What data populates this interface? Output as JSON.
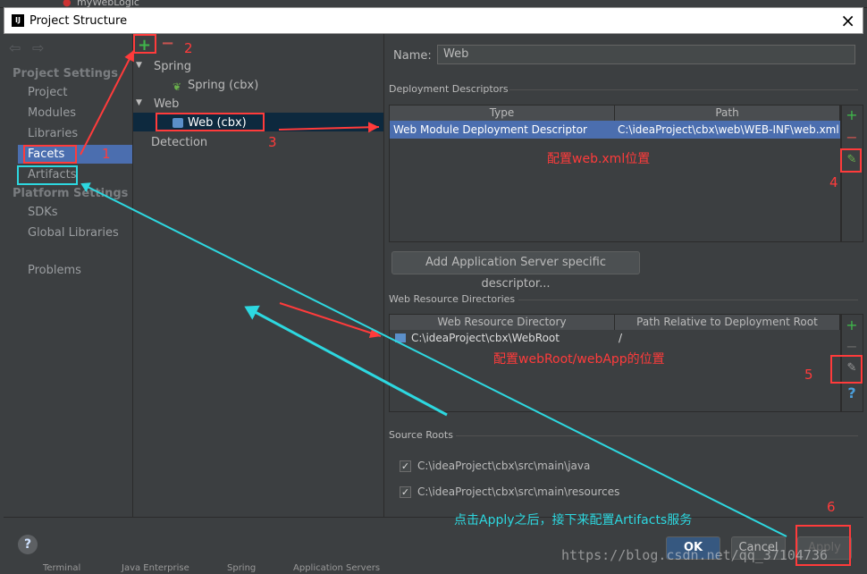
{
  "ide_toolbar": {
    "run_config": "myWebLogic"
  },
  "window": {
    "title": "Project Structure",
    "app_icon": "IJ"
  },
  "sidebar": {
    "project_settings_header": "Project Settings",
    "project_items": [
      "Project",
      "Modules",
      "Libraries",
      "Facets",
      "Artifacts"
    ],
    "platform_settings_header": "Platform Settings",
    "platform_items": [
      "SDKs",
      "Global Libraries"
    ],
    "problems": "Problems",
    "selected": "Facets"
  },
  "tree": {
    "spring": "Spring",
    "spring_child": "Spring (cbx)",
    "web": "Web",
    "web_child": "Web (cbx)",
    "detection": "Detection"
  },
  "facet": {
    "name_label": "Name:",
    "name_value": "Web",
    "deployment_descriptors": {
      "section_title": "Deployment Descriptors",
      "columns": [
        "Type",
        "Path"
      ],
      "rows": [
        {
          "type": "Web Module Deployment Descriptor",
          "path": "C:\\ideaProject\\cbx\\web\\WEB-INF\\web.xml"
        }
      ]
    },
    "add_server_descriptor_button": "Add Application Server specific descriptor...",
    "web_resource_directories": {
      "section_title": "Web Resource Directories",
      "columns": [
        "Web Resource Directory",
        "Path Relative to Deployment Root"
      ],
      "rows": [
        {
          "directory": "C:\\ideaProject\\cbx\\WebRoot",
          "relative": "/"
        }
      ]
    },
    "source_roots": {
      "section_title": "Source Roots",
      "items": [
        {
          "path": "C:\\ideaProject\\cbx\\src\\main\\java",
          "checked": true
        },
        {
          "path": "C:\\ideaProject\\cbx\\src\\main\\resources",
          "checked": true
        }
      ]
    }
  },
  "buttons": {
    "ok": "OK",
    "cancel": "Cancel",
    "apply": "Apply",
    "help": "?"
  },
  "annotations": {
    "n1": "1",
    "n2": "2",
    "n3": "3",
    "n4": "4",
    "n5": "5",
    "n6": "6",
    "webxml_note": "配置web.xml位置",
    "webroot_note": "配置webRoot/webApp的位置",
    "apply_note": "点击Apply之后，接下来配置Artifacts服务",
    "watermark": "https://blog.csdn.net/qq_37104736"
  },
  "status_bar": [
    "Terminal",
    "Java Enterprise",
    "Spring",
    "Application Servers"
  ],
  "colors": {
    "selection": "#4b6eaf",
    "annotation_red": "#ff3b3b",
    "annotation_cyan": "#2dd8e0",
    "add_green": "#3fb54a"
  }
}
